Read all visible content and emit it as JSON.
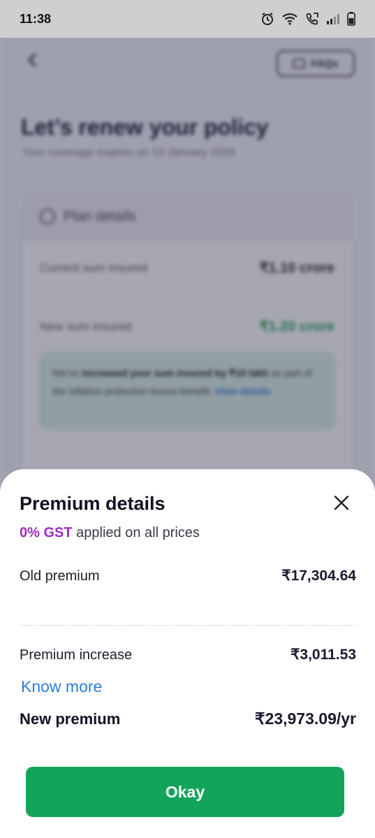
{
  "status_bar": {
    "time": "11:38",
    "icons": [
      "alarm-icon",
      "wifi-icon",
      "call-icon",
      "signal-icon",
      "battery-icon"
    ]
  },
  "background_page": {
    "faqs_label": "FAQs",
    "title": "Let’s renew your policy",
    "subtitle": "Your coverage expires on 10 January 2026",
    "plan_card": {
      "header": "Plan details",
      "current_sum_label": "Current sum insured",
      "current_sum_value": "₹1.10 crore",
      "new_sum_label": "New sum insured",
      "new_sum_value": "₹1.20 crore",
      "note_prefix": "We've ",
      "note_bold": "increased your sum insured by ₹10 lakh",
      "note_rest": " as part of the inflation protection bonus benefit. ",
      "note_link": "View details"
    }
  },
  "sheet": {
    "title": "Premium details",
    "gst_highlight": "0% GST",
    "gst_rest": " applied on all prices",
    "old_premium_label": "Old premium",
    "old_premium_value": "₹17,304.64",
    "increase_label": "Premium increase",
    "increase_value": "₹3,011.53",
    "know_more": "Know more",
    "new_premium_label": "New premium",
    "new_premium_value": "₹23,973.09/yr",
    "okay_label": "Okay"
  },
  "colors": {
    "accent_green": "#12a55a",
    "gst_purple": "#a22bc4",
    "link_blue": "#2a7fd6"
  }
}
